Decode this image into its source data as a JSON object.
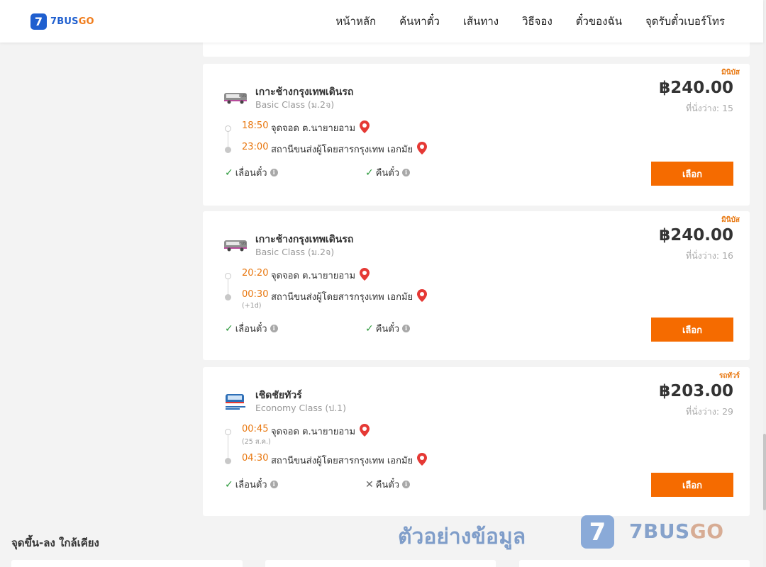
{
  "brand": {
    "logo_mark": "7",
    "name_main": "7BUS",
    "name_accent": "GO"
  },
  "nav": [
    "หน้าหลัก",
    "ค้นหาตั๋ว",
    "เส้นทาง",
    "วิธีจอง",
    "ตั๋วของฉัน",
    "จุดรับตั๋วเบอร์โทร"
  ],
  "trips": [
    {
      "type_badge": "มินิบัส",
      "operator": "เกาะช้างกรุงเทพเดินรถ",
      "bus_class": "Basic Class (ม.2จ)",
      "price": "฿240.00",
      "seats": "ที่นั่งว่าง: 15",
      "depart_time": "18:50",
      "depart_place": "จุดจอด ต.นายายอาม",
      "depart_note": "",
      "arrive_time": "23:00",
      "arrive_place": "สถานีขนส่งผู้โดยสารกรุงเทพ เอกมัย",
      "arrive_note": "",
      "change_label": "เลื่อนตั๋ว",
      "change_allowed": true,
      "refund_label": "คืนตั๋ว",
      "refund_allowed": true,
      "select_label": "เลือก",
      "logo_icon": "minibus-logo-icon"
    },
    {
      "type_badge": "มินิบัส",
      "operator": "เกาะช้างกรุงเทพเดินรถ",
      "bus_class": "Basic Class (ม.2จ)",
      "price": "฿240.00",
      "seats": "ที่นั่งว่าง: 16",
      "depart_time": "20:20",
      "depart_place": "จุดจอด ต.นายายอาม",
      "depart_note": "",
      "arrive_time": "00:30",
      "arrive_place": "สถานีขนส่งผู้โดยสารกรุงเทพ เอกมัย",
      "arrive_note": "(+1d)",
      "change_label": "เลื่อนตั๋ว",
      "change_allowed": true,
      "refund_label": "คืนตั๋ว",
      "refund_allowed": true,
      "select_label": "เลือก",
      "logo_icon": "minibus-logo-icon"
    },
    {
      "type_badge": "รถทัวร์",
      "operator": "เชิดชัยทัวร์",
      "bus_class": "Economy Class (ป.1)",
      "price": "฿203.00",
      "seats": "ที่นั่งว่าง: 29",
      "depart_time": "00:45",
      "depart_place": "จุดจอด ต.นายายอาม",
      "depart_note": "(25 ส.ค.)",
      "arrive_time": "04:30",
      "arrive_place": "สถานีขนส่งผู้โดยสารกรุงเทพ เอกมัย",
      "arrive_note": "",
      "change_label": "เลื่อนตั๋ว",
      "change_allowed": true,
      "refund_label": "คืนตั๋ว",
      "refund_allowed": false,
      "select_label": "เลือก",
      "logo_icon": "cherdchai-tour-logo-icon"
    }
  ],
  "watermark": {
    "text": "ตัวอย่างข้อมูล",
    "mark": "7",
    "brand_main": "7BUS",
    "brand_accent": "GO"
  },
  "nearby": {
    "title": "จุดขึ้น-ลง ใกล้เคียง"
  },
  "colors": {
    "accent": "#f56b00",
    "time": "#e8770f",
    "brand": "#1f5fcf",
    "check": "#2e9b3e",
    "pin": "#e53935"
  }
}
